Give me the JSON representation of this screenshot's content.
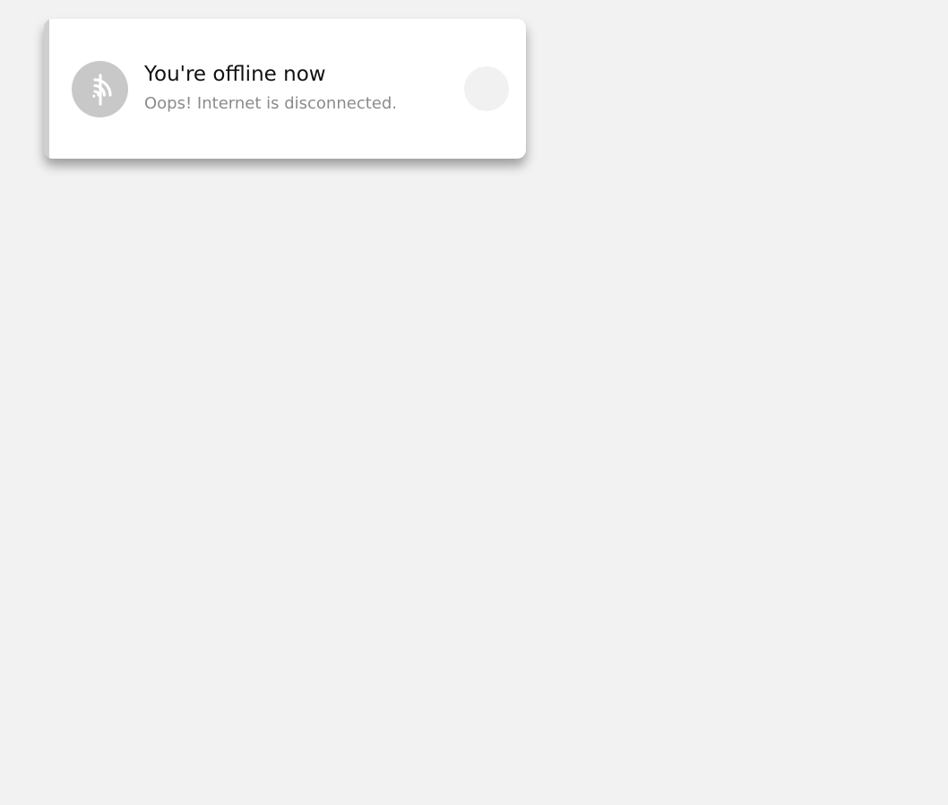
{
  "toast": {
    "title": "You're offline now",
    "message": "Oops! Internet is disconnected.",
    "icon": "wifi-off-icon",
    "colors": {
      "background": "#f2f2f2",
      "card": "#ffffff",
      "accent": "#cfcfcf",
      "icon_bg": "#c8c8c8",
      "title": "#111111",
      "message": "#8b8b8b",
      "close_bg": "#f1f1f1"
    }
  }
}
